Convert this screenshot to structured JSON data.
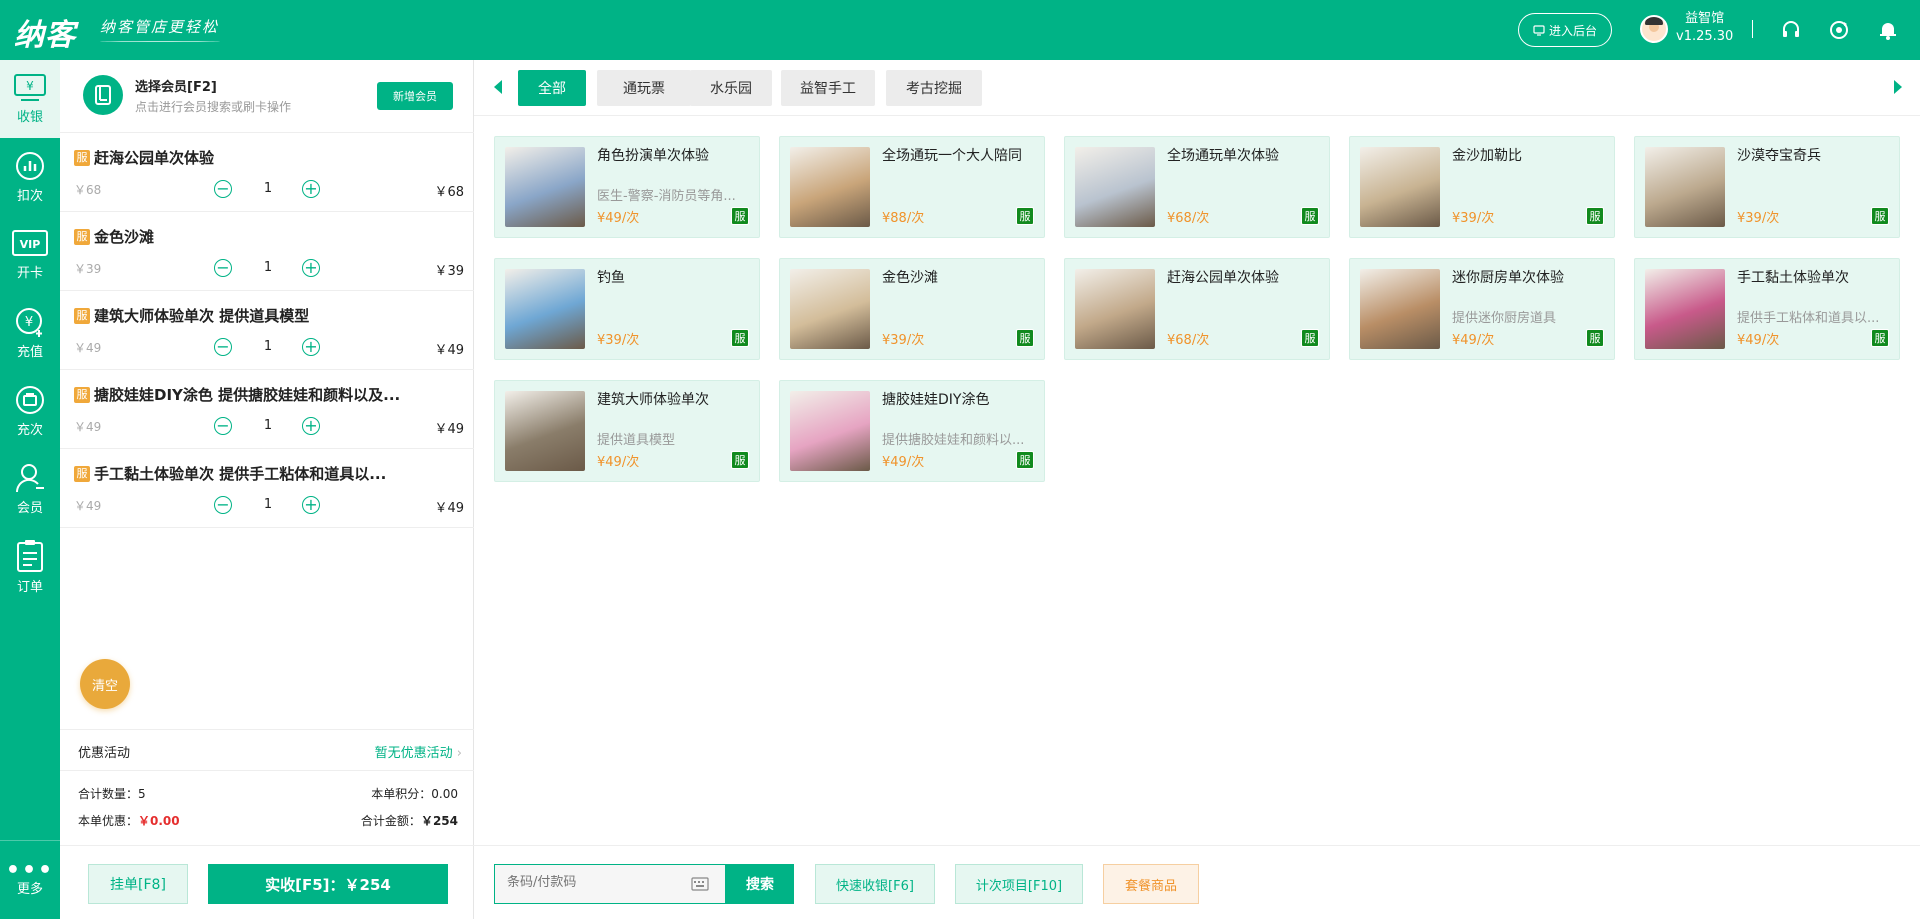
{
  "header": {
    "logo": "纳客",
    "slogan": "纳客管店更轻松",
    "admin_button": "进入后台",
    "shop_name": "益智馆",
    "version": "v1.25.30"
  },
  "sidebar": {
    "items": [
      {
        "label": "收银",
        "icon": "cashier-icon"
      },
      {
        "label": "扣次",
        "icon": "chart-icon"
      },
      {
        "label": "开卡",
        "icon": "vip-card-icon"
      },
      {
        "label": "充值",
        "icon": "recharge-icon"
      },
      {
        "label": "充次",
        "icon": "bag-icon"
      },
      {
        "label": "会员",
        "icon": "user-icon"
      },
      {
        "label": "订单",
        "icon": "clipboard-icon"
      }
    ],
    "more_label": "更多"
  },
  "member": {
    "title": "选择会员[F2]",
    "subtitle": "点击进行会员搜索或刷卡操作",
    "new_member_button": "新增会员"
  },
  "cart": {
    "badge": "服",
    "items": [
      {
        "name": "赶海公园单次体验",
        "price": "￥68",
        "qty": "1",
        "total": "￥68"
      },
      {
        "name": "金色沙滩",
        "price": "￥39",
        "qty": "1",
        "total": "￥39"
      },
      {
        "name": "建筑大师体验单次 提供道具模型",
        "price": "￥49",
        "qty": "1",
        "total": "￥49"
      },
      {
        "name": "搪胶娃娃DIY涂色 提供搪胶娃娃和颜料以及...",
        "price": "￥49",
        "qty": "1",
        "total": "￥49"
      },
      {
        "name": "手工黏土体验单次 提供手工粘体和道具以...",
        "price": "￥49",
        "qty": "1",
        "total": "￥49"
      }
    ],
    "clear_button": "清空",
    "promo_label": "优惠活动",
    "promo_value": "暂无优惠活动",
    "total_qty_label": "合计数量：",
    "total_qty": "5",
    "points_label": "本单积分：",
    "points": "0.00",
    "discount_label": "本单优惠：",
    "discount": "￥0.00",
    "amount_label": "合计金额：",
    "amount": "￥254",
    "hold_button": "挂单[F8]",
    "pay_button": "实收[F5]：￥254"
  },
  "tabs": [
    "全部",
    "通玩票",
    "水乐园",
    "益智手工",
    "考古挖掘"
  ],
  "products": [
    {
      "name": "角色扮演单次体验",
      "desc": "医生-警察-消防员等角...",
      "price": "¥49/次",
      "thumb": "#8aa6c8"
    },
    {
      "name": "全场通玩一个大人陪同",
      "desc": "",
      "price": "¥88/次",
      "thumb": "#c9a57a"
    },
    {
      "name": "全场通玩单次体验",
      "desc": "",
      "price": "¥68/次",
      "thumb": "#b9c3cf"
    },
    {
      "name": "金沙加勒比",
      "desc": "",
      "price": "¥39/次",
      "thumb": "#c8b392"
    },
    {
      "name": "沙漠夺宝奇兵",
      "desc": "",
      "price": "¥39/次",
      "thumb": "#bca98e"
    },
    {
      "name": "钓鱼",
      "desc": "",
      "price": "¥39/次",
      "thumb": "#6fa7d4"
    },
    {
      "name": "金色沙滩",
      "desc": "",
      "price": "¥39/次",
      "thumb": "#d3bd9a"
    },
    {
      "name": "赶海公园单次体验",
      "desc": "",
      "price": "¥68/次",
      "thumb": "#c2a98a"
    },
    {
      "name": "迷你厨房单次体验",
      "desc": "提供迷你厨房道具",
      "price": "¥49/次",
      "thumb": "#b98e66"
    },
    {
      "name": "手工黏土体验单次",
      "desc": "提供手工粘体和道具以...",
      "price": "¥49/次",
      "thumb": "#c85a8a"
    },
    {
      "name": "建筑大师体验单次",
      "desc": "提供道具模型",
      "price": "¥49/次",
      "thumb": "#8a7d6a"
    },
    {
      "name": "搪胶娃娃DIY涂色",
      "desc": "提供搪胶娃娃和颜料以...",
      "price": "¥49/次",
      "thumb": "#e6a4c2"
    }
  ],
  "product_badge": "服",
  "search": {
    "placeholder": "条码/付款码",
    "button": "搜索"
  },
  "actions": {
    "quick_cash": "快速收银[F6]",
    "count_item": "计次项目[F10]",
    "package": "套餐商品"
  },
  "colors": {
    "brand": "#00b386",
    "price": "#f0932b",
    "badge": "#118a1e"
  }
}
